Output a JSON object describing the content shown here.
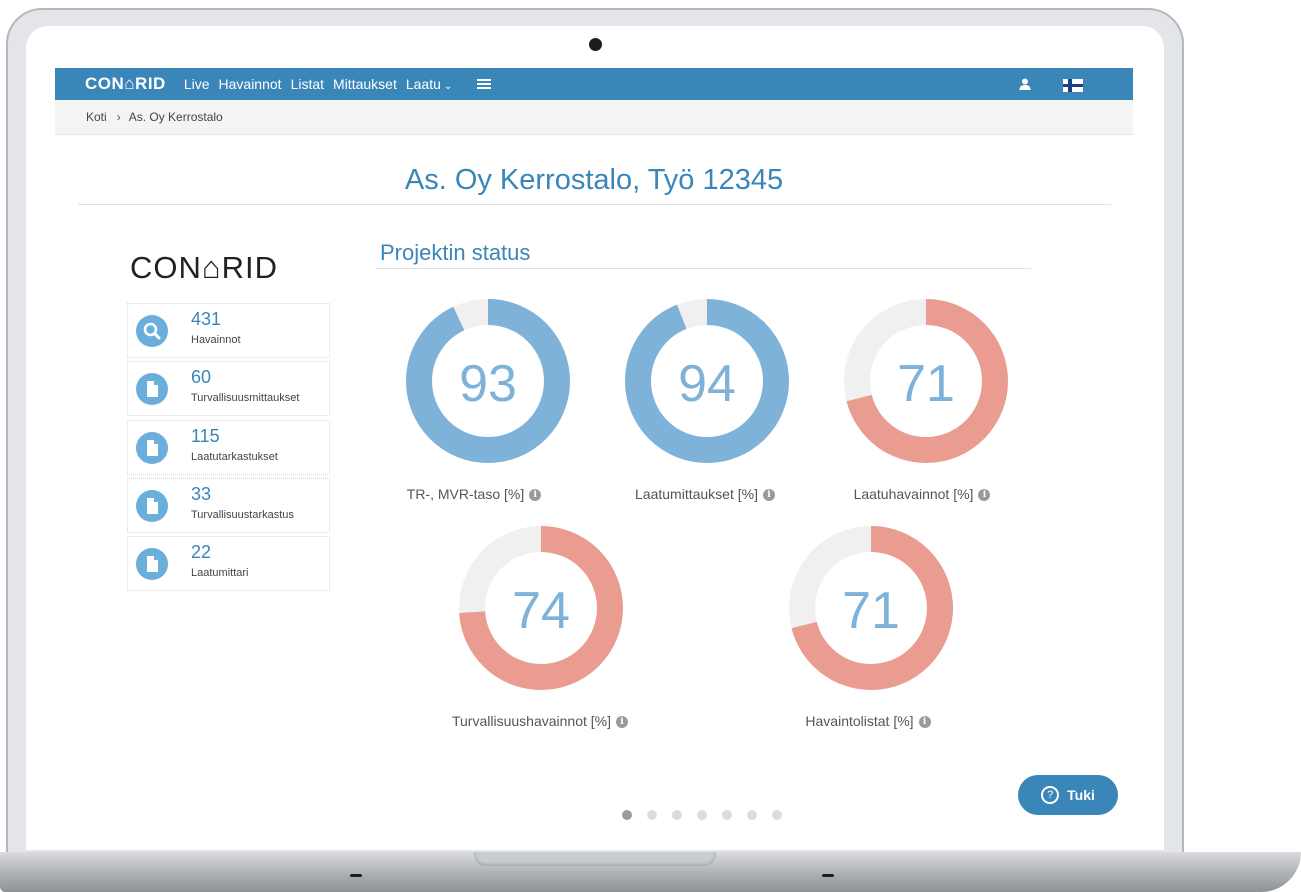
{
  "nav": {
    "brand": "CON⌂RID",
    "items": [
      "Live",
      "Havainnot",
      "Listat",
      "Mittaukset",
      "Laatu"
    ],
    "dropdown_caret": "⌄"
  },
  "breadcrumb": {
    "home": "Koti",
    "separator": "›",
    "current": "As. Oy Kerrostalo"
  },
  "page_title": "As. Oy Kerrostalo, Työ 12345",
  "side_logo": "CON⌂RID",
  "stats": [
    {
      "value": "431",
      "label": "Havainnot",
      "icon": "search-icon"
    },
    {
      "value": "60",
      "label": "Turvallisuusmittaukset",
      "icon": "document-icon"
    },
    {
      "value": "115",
      "label": "Laatutarkastukset",
      "icon": "document-icon"
    },
    {
      "value": "33",
      "label": "Turvallisuustarkastus",
      "icon": "document-icon"
    },
    {
      "value": "22",
      "label": "Laatumittari",
      "icon": "document-icon"
    }
  ],
  "section_title": "Projektin status",
  "info_glyph": "i",
  "gauges": [
    {
      "value": 93,
      "display": "93",
      "label": "TR-, MVR-taso [%]",
      "color": "#7fb2d8"
    },
    {
      "value": 94,
      "display": "94",
      "label": "Laatumittaukset [%]",
      "color": "#7fb2d8"
    },
    {
      "value": 71,
      "display": "71",
      "label": "Laatuhavainnot [%]",
      "color": "#e99c8f"
    },
    {
      "value": 74,
      "display": "74",
      "label": "Turvallisuushavainnot [%]",
      "color": "#e99c8f"
    },
    {
      "value": 71,
      "display": "71",
      "label": "Havaintolistat [%]",
      "color": "#e99c8f"
    }
  ],
  "gauge_track_color": "#f0f0f0",
  "pager": {
    "count": 7,
    "active": 0
  },
  "support": {
    "label": "Tuki",
    "icon_glyph": "?"
  },
  "colors": {
    "nav_bg": "#3a86b9",
    "accent": "#3a86b9",
    "stat_icon": "#6aaedb"
  }
}
